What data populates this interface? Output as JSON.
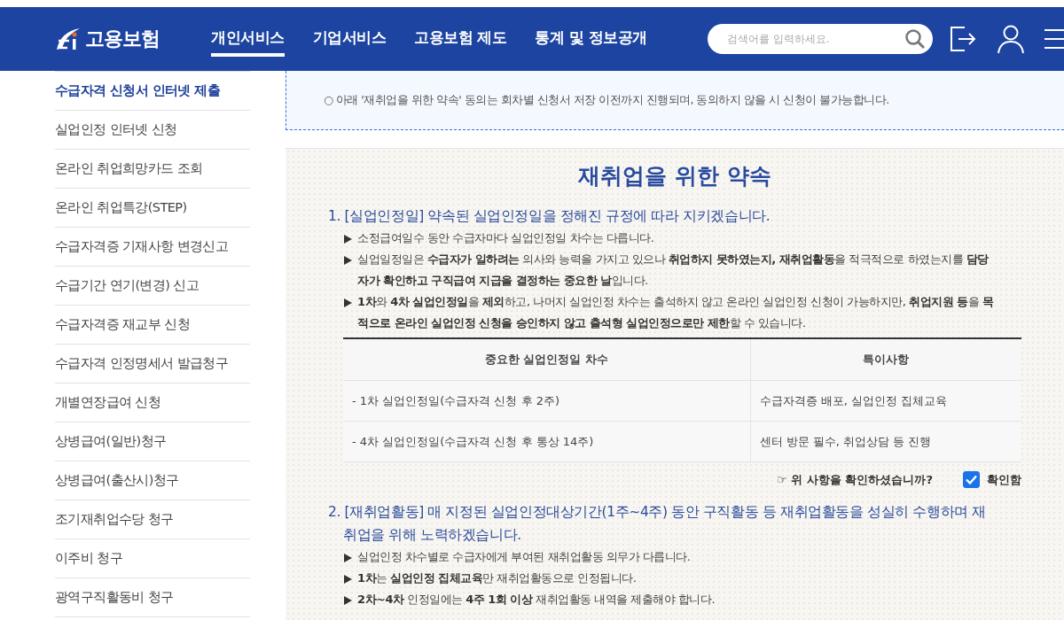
{
  "header": {
    "logo_text": "고용보험",
    "nav": [
      {
        "label": "개인서비스",
        "selected": true
      },
      {
        "label": "기업서비스",
        "selected": false
      },
      {
        "label": "고용보험 제도",
        "selected": false
      },
      {
        "label": "통계 및 정보공개",
        "selected": false
      }
    ],
    "search": {
      "placeholder": "검색어를 입력하세요."
    }
  },
  "sidebar": {
    "items": [
      {
        "label": "수급자격 신청서 인터넷 제출",
        "selected": true
      },
      {
        "label": "실업인정 인터넷 신청",
        "selected": false
      },
      {
        "label": "온라인 취업희망카드 조회",
        "selected": false
      },
      {
        "label": "온라인 취업특강(STEP)",
        "selected": false
      },
      {
        "label": "수급자격증 기재사항 변경신고",
        "selected": false
      },
      {
        "label": "수급기간 연기(변경) 신고",
        "selected": false
      },
      {
        "label": "수급자격증 재교부 신청",
        "selected": false
      },
      {
        "label": "수급자격 인정명세서 발급청구",
        "selected": false
      },
      {
        "label": "개별연장급여 신청",
        "selected": false
      },
      {
        "label": "상병급여(일반)청구",
        "selected": false
      },
      {
        "label": "상병급여(출산시)청구",
        "selected": false
      },
      {
        "label": "조기재취업수당 청구",
        "selected": false
      },
      {
        "label": "이주비 청구",
        "selected": false
      },
      {
        "label": "광역구직활동비 청구",
        "selected": false
      }
    ]
  },
  "notice": "○ 아래 '재취업을 위한 약속' 동의는 회차별 신청서 저장 이전까지 진행되며, 동의하지 않을 시 신청이 불가능합니다.",
  "promise": {
    "title": "재취업을 위한 약속",
    "items": [
      {
        "heading": "1. [실업인정일] 약속된 실업인정일을 정해진 규정에 따라 지키겠습니다.",
        "bullets": [
          "소정급여일수 동안 수급자마다 실업인정일 차수는 다릅니다.",
          "실업일정일은 **수급자가 일하려는** 의사와 능력을 가지고 있으나 **취업하지 못하였는지, 재취업활동**을 적극적으로 하였는지를 **담당자가 확인하고 구직급여 지급을 결정하는 중요한 날**입니다.",
          "**1차**와 **4차 실업인정일**을 **제외**하고, 나머지 실업인정 차수는 출석하지 않고 온라인 실업인정 신청이 가능하지만, **취업지원 등**을 **목적으로 온라인 실업인정 신청을 승인하지 않고 출석형 실업인정으로만 제한**할 수 있습니다."
        ],
        "table": {
          "columns": [
            "중요한 실업인정일 차수",
            "특이사항"
          ],
          "rows": [
            [
              "- 1차 실업인정일(수급자격 신청 후 2주)",
              "수급자격증 배포, 실업인정 집체교육"
            ],
            [
              "- 4차 실업인정일(수급자격 신청 후 통상 14주)",
              "센터 방문 필수, 취업상담 등 진행"
            ]
          ]
        },
        "confirm": {
          "question": "☞ 위 사항을 확인하셨습니까?",
          "label": "확인함",
          "checked": true
        }
      },
      {
        "heading": "2. [재취업활동] 매 지정된 실업인정대상기간(1주~4주) 동안 구직활동 등 재취업활동을 성실히 수행하며 재취업을 위해 노력하겠습니다.",
        "bullets": [
          "실업인정 차수별로 수급자에게 부여된 재취업활동 의무가 다릅니다.",
          "**1차**는 **실업인정 집체교육**만 재취업활동으로 인정됩니다.",
          "**2차~4차** 인정일에는 **4주 1회 이상** 재취업활동 내역을 제출해야 합니다."
        ]
      }
    ]
  }
}
